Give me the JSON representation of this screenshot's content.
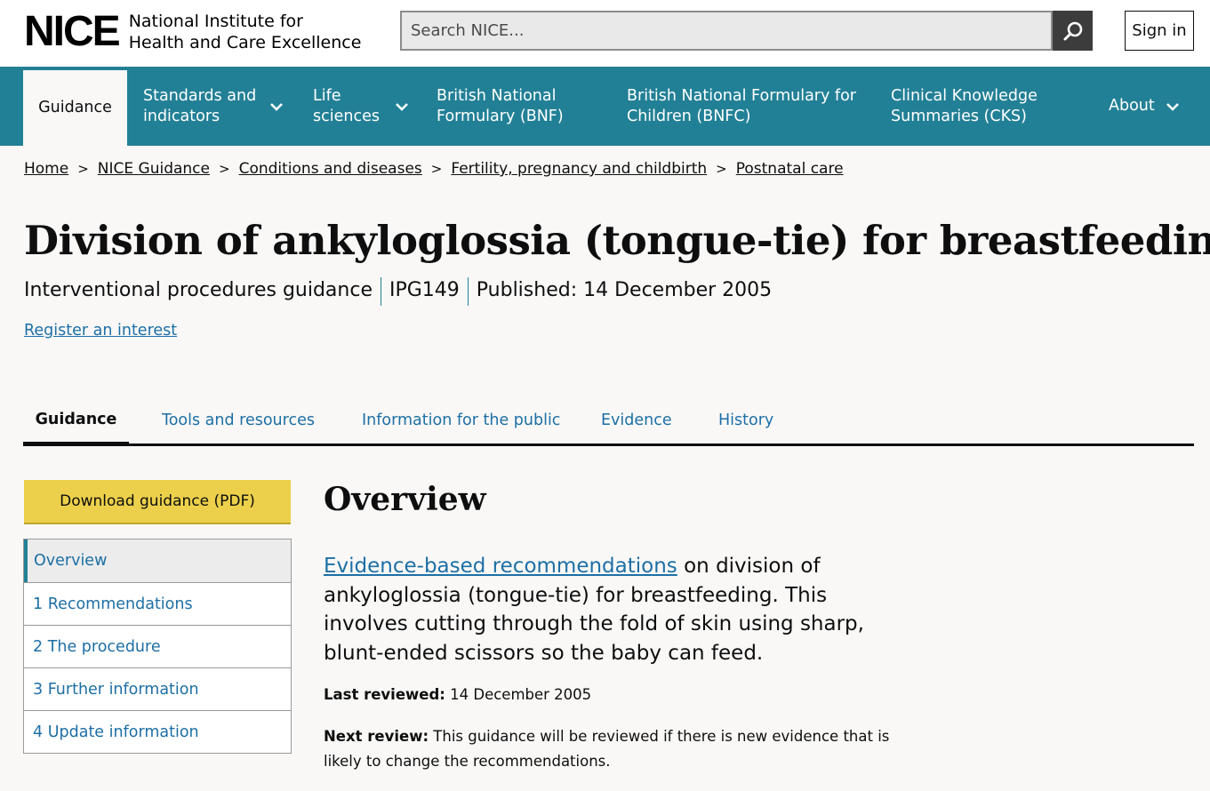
{
  "header": {
    "logo_mark": "NICE",
    "logo_line1": "National Institute for",
    "logo_line2": "Health and Care Excellence",
    "search_placeholder": "Search NICE...",
    "sign_in": "Sign in"
  },
  "nav": {
    "items": [
      {
        "label": "Guidance",
        "active": true
      },
      {
        "label": "Standards and indicators",
        "dropdown": true
      },
      {
        "label": "Life sciences",
        "dropdown": true
      },
      {
        "label": "British National Formulary (BNF)"
      },
      {
        "label": "British National Formulary for Children (BNFC)"
      },
      {
        "label": "Clinical Knowledge Summaries (CKS)"
      },
      {
        "label": "About",
        "dropdown": true
      }
    ]
  },
  "breadcrumb": [
    "Home",
    "NICE Guidance",
    "Conditions and diseases",
    "Fertility, pregnancy and childbirth",
    "Postnatal care"
  ],
  "page": {
    "title": "Division of ankyloglossia (tongue-tie) for breastfeeding",
    "type": "Interventional procedures guidance",
    "code": "IPG149",
    "published": "Published: 14 December 2005",
    "register": "Register an interest"
  },
  "tabs": [
    "Guidance",
    "Tools and resources",
    "Information for the public",
    "Evidence",
    "History"
  ],
  "sidebar": {
    "download": "Download guidance (PDF)",
    "items": [
      "Overview",
      "1 Recommendations",
      "2 The procedure",
      "3 Further information",
      "4 Update information"
    ]
  },
  "main": {
    "heading": "Overview",
    "lead_link": "Evidence-based recommendations",
    "lead_text": " on division of ankyloglossia (tongue-tie) for breastfeeding. This involves cutting through the fold of skin using sharp, blunt-ended scissors so the baby can feed.",
    "last_reviewed_label": "Last reviewed:",
    "last_reviewed_value": " 14 December 2005",
    "next_review_label": "Next review:",
    "next_review_value": " This guidance will be reviewed if there is new evidence that is likely to change the recommendations."
  },
  "colors": {
    "nav_bg": "#228096",
    "link": "#1d6fa5",
    "download_bg": "#ecd04b",
    "page_bg": "#f9f8f7"
  }
}
